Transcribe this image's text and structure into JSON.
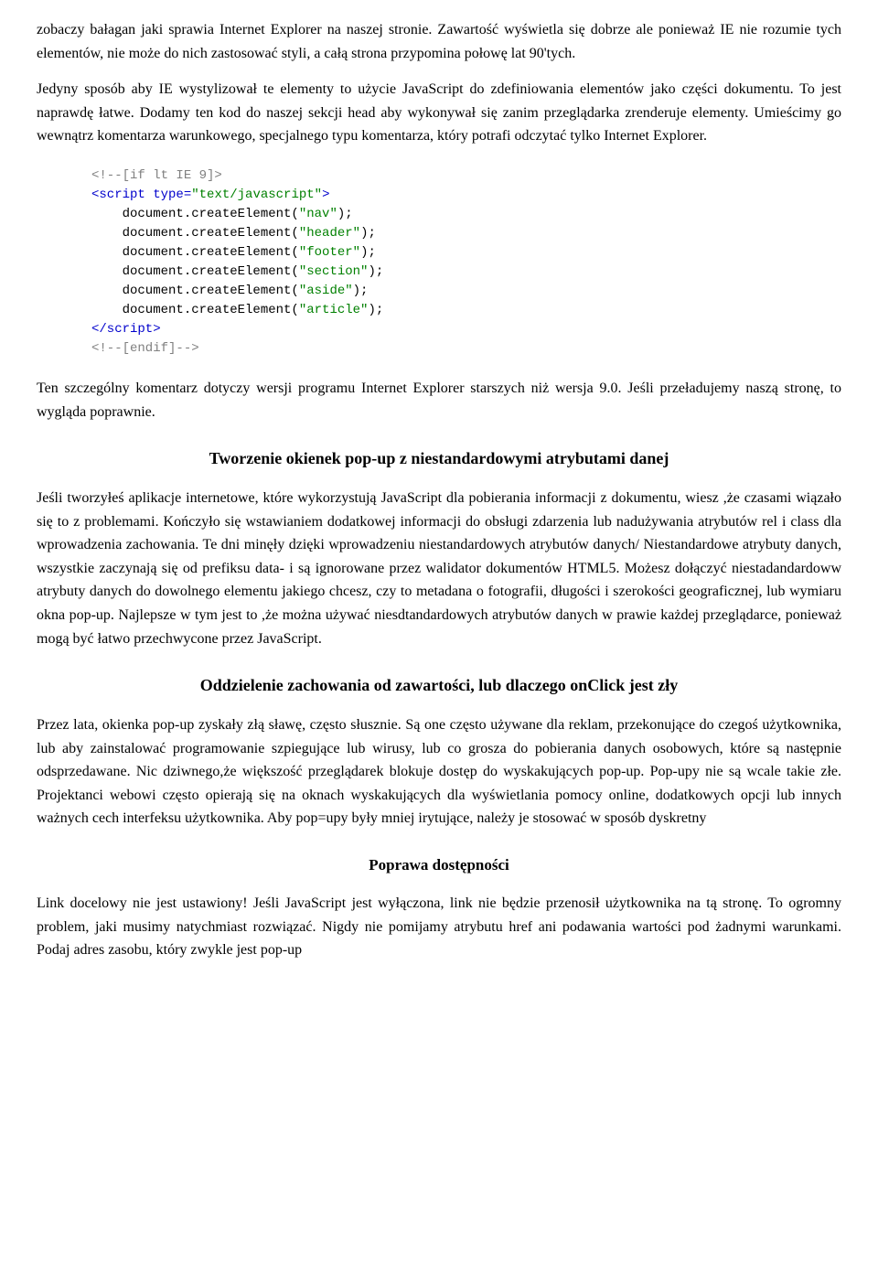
{
  "article": {
    "paragraphs": {
      "p1": "zobaczy bałagan jaki sprawia Internet Explorer na naszej stronie. Zawartość wyświetla się dobrze ale ponieważ IE nie rozumie tych elementów, nie może do nich zastosować styli, a całą strona przypomina połowę lat 90'tych.",
      "p2": "Jedyny sposób aby IE wystylizował te elementy to użycie JavaScript do zdefiniowania elementów jako części dokumentu. To jest naprawdę łatwe. Dodamy ten kod do naszej sekcji head aby wykonywał się zanim przeglądarka zrenderuje elementy. Umieścimy go wewnątrz komentarza warunkowego, specjalnego typu komentarza, który potrafi odczytać tylko Internet Explorer.",
      "p3": "Ten szczególny komentarz dotyczy wersji programu Internet Explorer starszych niż wersja 9.0. Jeśli przeładujemy naszą stronę, to wygląda poprawnie.",
      "p4": "Jeśli tworzyłeś aplikacje internetowe, które wykorzystują JavaScript dla pobierania informacji z dokumentu, wiesz ,że czasami wiązało się to z problemami. Kończyło się wstawianiem dodatkowej informacji do obsługi zdarzenia lub nadużywania atrybutów rel i class dla wprowadzenia zachowania. Te dni minęły dzięki wprowadzeniu niestandardowych atrybutów danych/ Niestandardowe atrybuty danych, wszystkie zaczynają się od prefiksu data- i są ignorowane przez walidator dokumentów HTML5. Możesz dołączyć niestadandardoww atrybuty danych do dowolnego elementu jakiego chcesz, czy to metadana o fotografii, długości i szerokości geograficznej, lub wymiaru okna pop-up. Najlepsze w tym jest to ,że można używać niesdtandardowych atrybutów danych w prawie każdej przeglądarce, ponieważ mogą być łatwo przechwycone przez JavaScript.",
      "p5": "Przez lata, okienka pop-up zyskały złą sławę, często słusznie. Są one często używane dla reklam, przekonujące do czegoś użytkownika, lub aby zainstalować programowanie szpiegujące lub wirusy, lub co grosza do pobierania danych osobowych, które są następnie odsprzedawane. Nic dziwnego,że większość przeglądarek blokuje dostęp do wyskakujących pop-up. Pop-upy nie są wcale takie złe. Projektanci webowi często opierają się na oknach wyskakujących dla wyświetlania pomocy online, dodatkowych opcji lub innych ważnych cech interfeksu użytkownika. Aby pop=upy były mniej irytujące, należy je stosować w sposób dyskretny",
      "p6": "Link docelowy nie jest ustawiony! Jeśli JavaScript jest wyłączona, link nie będzie przenosił użytkownika na tą stronę. To ogromny problem, jaki musimy natychmiast rozwiązać. Nigdy nie pomijamy atrybutu href ani podawania wartości pod żadnymi warunkami. Podaj adres zasobu, który zwykle jest pop-up"
    },
    "headings": {
      "h1": "Tworzenie okienek pop-up z niestandardowymi atrybutami danej",
      "h2": "Oddzielenie zachowania od zawartości, lub dlaczego onClick jest zły",
      "h3": "Poprawa dostępności"
    },
    "code": {
      "line1": "<!--[if lt IE 9]>",
      "line2": "<script type=\"text/javascript\">",
      "line3": "    document.createElement(\"nav\");",
      "line4": "    document.createElement(\"header\");",
      "line5": "    document.createElement(\"footer\");",
      "line6": "    document.createElement(\"section\");",
      "line7": "    document.createElement(\"aside\");",
      "line8": "    document.createElement(\"article\");",
      "line9": "<\\/script>",
      "line10": "<!--[endif]-->"
    }
  }
}
